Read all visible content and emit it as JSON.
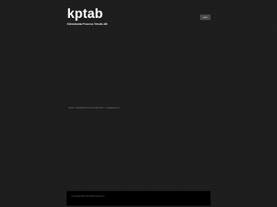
{
  "header": {
    "title": "kptab",
    "tagline": "Klinisksida Process Teknik AB"
  },
  "nav": {
    "button_label": "Hem"
  },
  "contact": {
    "company": "kptab - Klinisksida Process Teknik AB",
    "separator": "|",
    "email": "info@kptab.se"
  },
  "footer": {
    "copyright": "Copyright 2013 All Rights Reserved"
  }
}
